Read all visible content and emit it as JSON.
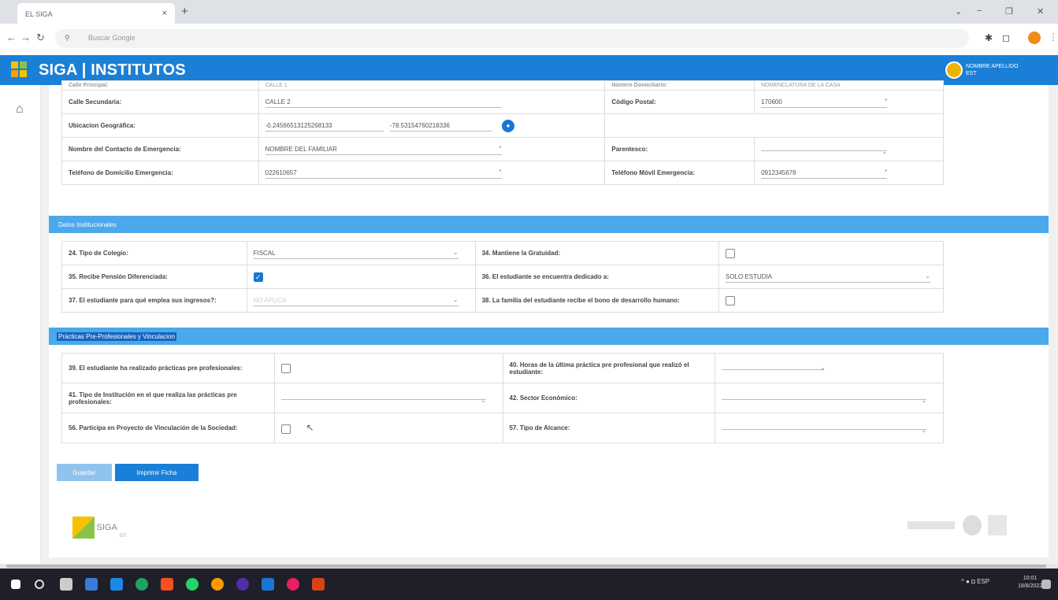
{
  "browser": {
    "tab_title": "EL SIGA",
    "tab_close": "×",
    "new_tab": "+",
    "search_placeholder": "Buscar Google"
  },
  "app": {
    "title": "SIGA | INSTITUTOS",
    "user_name": "NOMBRE APELLIDO",
    "user_role": "EST"
  },
  "personal": {
    "top_label_left": "Calle Principal:",
    "top_value_left": "CALLE 1",
    "top_label_right": "Número Domiciliario:",
    "top_value_right": "NOMENCLATURA DE LA CASA",
    "rows": [
      {
        "label": "Calle Secundaria:",
        "value": "CALLE 2",
        "label2": "Código Postal:",
        "value2": "170600"
      },
      {
        "label": "Ubicacion Geográfica:",
        "value": "-0.24566513125268133",
        "value_b": "-78.53154760218336"
      },
      {
        "label": "Nombre del Contacto de Emergencia:",
        "value": "NOMBRE DEL FAMILIAR",
        "label2": "Parentesco:",
        "value2": ""
      },
      {
        "label": "Teléfono de Domicilio Emergencia:",
        "value": "022610657",
        "label2": "Teléfono Móvil Emergencia:",
        "value2": "0912345678"
      }
    ]
  },
  "sections": {
    "institucional": "Datos Institucionales",
    "practicas": "Prácticas Pre-Profesionales y Vinculacion"
  },
  "institucional": {
    "q24": "24. Tipo de Colegio:",
    "q24_value": "FISCAL",
    "q34": "34. Mantiene la Gratuidad:",
    "q35": "35. Recibe Pensión Diferenciada:",
    "q36": "36. El estudiante se encuentra dedicado a:",
    "q36_value": "SOLO ESTUDIA",
    "q37": "37. El estudiante para qué emplea sus ingresos?:",
    "q37_value": "NO APLICA",
    "q38": "38. La familia del estudiante recibe el bono de desarrollo humano:"
  },
  "practicas": {
    "q39": "39. El estudiante ha realizado prácticas pre profesionales:",
    "q40": "40. Horas de la última práctica pre profesional que realizó el estudiante:",
    "q41": "41. Tipo de Institución en el que realiza las prácticas pre profesionales:",
    "q42": "42. Sector Económico:",
    "q56": "56. Participa en Proyecto de Vinculación de la Sociedad:",
    "q57": "57. Tipo de Alcance:"
  },
  "buttons": {
    "save": "Guardar",
    "print": "Imprimir Ficha"
  },
  "footer": {
    "logo_text": "SIGA",
    "logo_sub": "IST"
  },
  "taskbar": {
    "lang": "ESP",
    "time": "10:01",
    "date": "18/8/2022"
  }
}
